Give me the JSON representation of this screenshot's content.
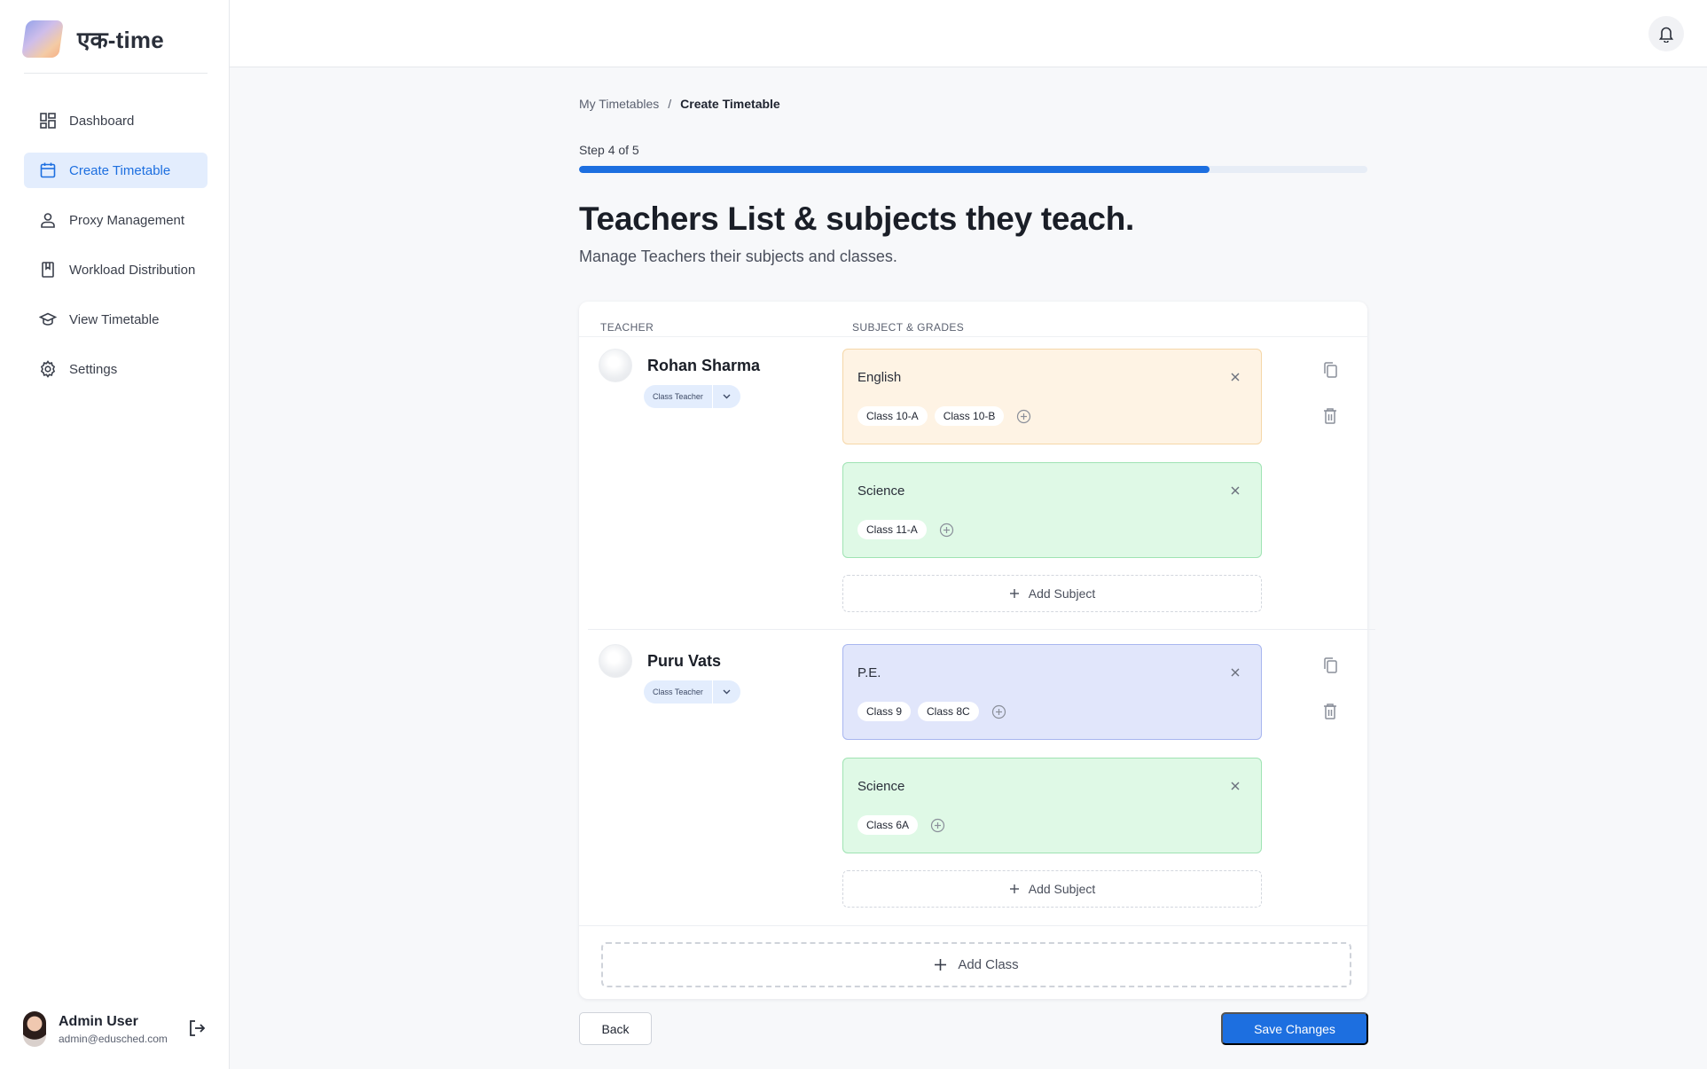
{
  "app": {
    "brand_name": "एक-time"
  },
  "sidebar": {
    "items": [
      {
        "label": "Dashboard",
        "icon": "dashboard-icon",
        "active": false
      },
      {
        "label": "Create Timetable",
        "icon": "calendar-icon",
        "active": true
      },
      {
        "label": "Proxy Management",
        "icon": "user-icon",
        "active": false
      },
      {
        "label": "Workload Distribution",
        "icon": "bookmark-icon",
        "active": false
      },
      {
        "label": "View Timetable",
        "icon": "graduation-cap-icon",
        "active": false
      },
      {
        "label": "Settings",
        "icon": "gear-icon",
        "active": false
      }
    ],
    "user": {
      "name": "Admin User",
      "email": "admin@edusched.com"
    }
  },
  "breadcrumb": {
    "parent": "My Timetables",
    "separator": "/",
    "current": "Create Timetable"
  },
  "step": {
    "label": "Step 4 of 5",
    "progress": 0.8
  },
  "page": {
    "title": "Teachers List & subjects they teach.",
    "subtitle": "Manage Teachers their subjects and classes."
  },
  "table": {
    "headers": {
      "teacher": "TEACHER",
      "subjects": "SUBJECT & GRADES"
    },
    "add_subject_label": "Add Subject",
    "add_class_label": "Add Class",
    "teachers": [
      {
        "name": "Rohan Sharma",
        "role": "Class Teacher",
        "subjects": [
          {
            "name": "English",
            "color": "#fef3e4",
            "classes": [
              "Class 10-A",
              "Class 10-B"
            ]
          },
          {
            "name": "Science",
            "color": "#dff9e6",
            "classes": [
              "Class 11-A"
            ]
          }
        ]
      },
      {
        "name": "Puru Vats",
        "role": "Class Teacher",
        "subjects": [
          {
            "name": "P.E.",
            "color": "#e1e6fb",
            "classes": [
              "Class 9",
              "Class 8C"
            ]
          },
          {
            "name": "Science",
            "color": "#dff9e6",
            "classes": [
              "Class 6A"
            ]
          }
        ]
      }
    ]
  },
  "actions": {
    "back": "Back",
    "save": "Save Changes"
  },
  "colors": {
    "accent": "#1d6fe0",
    "active_nav_bg": "#e3edfd"
  }
}
